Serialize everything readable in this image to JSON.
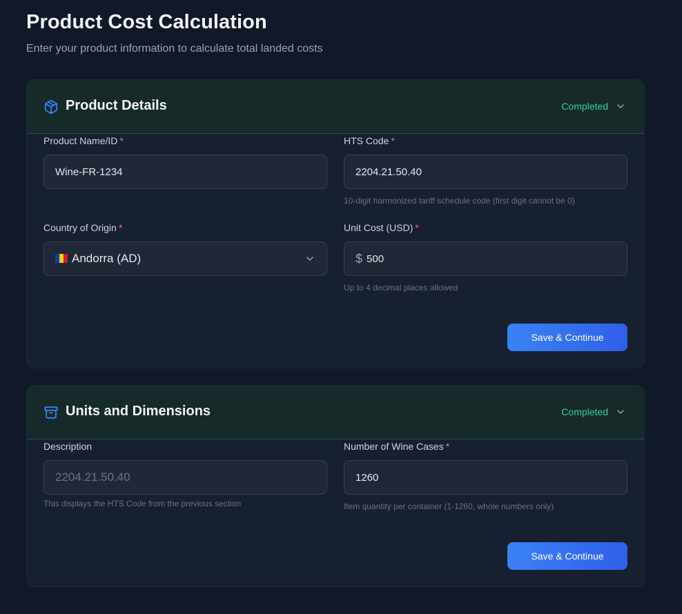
{
  "page": {
    "title": "Product Cost Calculation",
    "subtitle": "Enter your product information to calculate total landed costs"
  },
  "sections": [
    {
      "title": "Product Details",
      "status": "Completed",
      "icon": "package-icon",
      "fields": {
        "product_name": {
          "label": "Product Name/ID",
          "required": "*",
          "value": "Wine-FR-1234"
        },
        "hts_code": {
          "label": "HTS Code",
          "required": "*",
          "value": "2204.21.50.40",
          "hint": "10-digit harmonized tariff schedule code (first digit cannot be 0)"
        },
        "country": {
          "label": "Country of Origin",
          "required": "*",
          "value": "Andorra (AD)"
        },
        "unit_cost": {
          "label": "Unit Cost (USD)",
          "required": "*",
          "prefix": "$",
          "value": "500",
          "hint": "Up to 4 decimal places allowed"
        }
      },
      "button": "Save & Continue"
    },
    {
      "title": "Units and Dimensions",
      "status": "Completed",
      "icon": "archive-icon",
      "fields": {
        "description": {
          "label": "Description",
          "value": "2204.21.50.40",
          "hint": "This displays the HTS Code from the previous section"
        },
        "wine_cases": {
          "label": "Number of Wine Cases",
          "required": "*",
          "value": "1260",
          "hint": "Item quantity per container (1-1260, whole numbers only)"
        }
      },
      "button": "Save & Continue"
    }
  ],
  "colors": {
    "background": "#111827",
    "accent": "#3b82f6",
    "status": "#34d399",
    "required": "#f87171"
  }
}
